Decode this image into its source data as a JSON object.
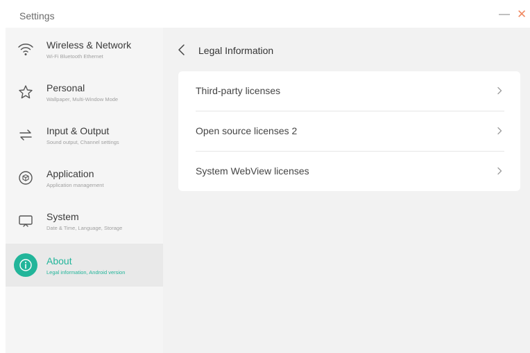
{
  "window": {
    "title": "Settings",
    "minimize_symbol": "—",
    "close_symbol": "✕"
  },
  "sidebar": {
    "items": [
      {
        "label": "Wireless & Network",
        "sub": "Wi-Fi Bluetooth Ethernet",
        "icon": "wifi-icon"
      },
      {
        "label": "Personal",
        "sub": "Wallpaper, Multi-Window Mode",
        "icon": "star-icon"
      },
      {
        "label": "Input & Output",
        "sub": "Sound output, Channel settings",
        "icon": "swap-arrows-icon"
      },
      {
        "label": "Application",
        "sub": "Application management",
        "icon": "cube-icon"
      },
      {
        "label": "System",
        "sub": "Date & Time, Language, Storage",
        "icon": "monitor-icon"
      },
      {
        "label": "About",
        "sub": "Legal information, Android version",
        "icon": "info-icon",
        "active": true
      }
    ]
  },
  "main": {
    "title": "Legal Information",
    "rows": [
      {
        "label": "Third-party licenses"
      },
      {
        "label": "Open source licenses 2"
      },
      {
        "label": "System WebView licenses"
      }
    ]
  },
  "colors": {
    "accent": "#22b59a",
    "close": "#f08a63",
    "sidebar_bg": "#f5f5f5",
    "content_bg": "#f2f2f2"
  }
}
